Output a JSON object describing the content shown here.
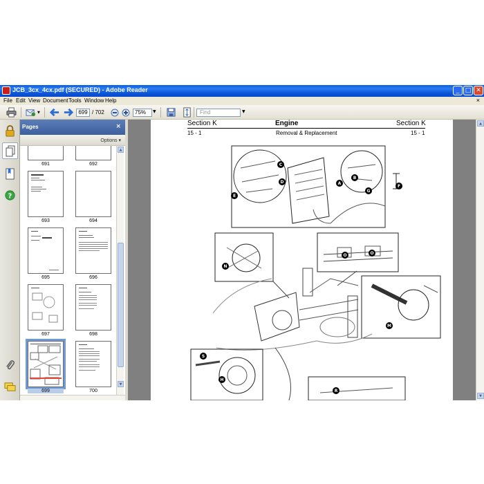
{
  "window": {
    "title": "JCB_3cx_4cx.pdf (SECURED) - Adobe Reader",
    "min_glyph": "_",
    "max_glyph": "□",
    "close_glyph": "✕"
  },
  "menu": {
    "items": [
      "File",
      "Edit",
      "View",
      "Document",
      "Tools",
      "Window",
      "Help"
    ],
    "close_glyph": "×"
  },
  "toolbar": {
    "page_value": "699",
    "page_total": "/ 702",
    "zoom_value": "75%",
    "find_placeholder": "Find",
    "dropdown_glyph": "▼"
  },
  "pages_panel": {
    "title": "Pages",
    "close_glyph": "×",
    "options_label": "Options ▾",
    "thumbnails": [
      {
        "label": "691",
        "selected": false
      },
      {
        "label": "692",
        "selected": false
      },
      {
        "label": "693",
        "selected": false
      },
      {
        "label": "694",
        "selected": false
      },
      {
        "label": "695",
        "selected": false
      },
      {
        "label": "696",
        "selected": false
      },
      {
        "label": "697",
        "selected": false
      },
      {
        "label": "698",
        "selected": false
      },
      {
        "label": "699",
        "selected": true
      },
      {
        "label": "700",
        "selected": false
      }
    ]
  },
  "document": {
    "section_left": "Section K",
    "section_title": "Engine",
    "section_right": "Section K",
    "page_left": "15 - 1",
    "subtitle": "Removal & Replacement",
    "page_right": "15 - 1",
    "callouts": [
      "C",
      "D",
      "E",
      "A",
      "B",
      "G",
      "F",
      "N",
      "O",
      "O",
      "M",
      "S",
      "H",
      "R"
    ]
  },
  "icons": {
    "nav": [
      "lock-icon",
      "pages-icon",
      "bookmarks-icon",
      "help-icon",
      "attachments-icon",
      "comments-icon"
    ],
    "toolbar": [
      "print-icon",
      "email-icon",
      "previous-page-icon",
      "next-page-icon",
      "zoom-out-icon",
      "zoom-in-icon",
      "save-icon",
      "fit-page-icon"
    ]
  },
  "colors": {
    "titlebar": "#0a5de0",
    "panel_header": "#4a6ca9",
    "selection": "#6f9ad6",
    "doc_background": "#808080"
  }
}
